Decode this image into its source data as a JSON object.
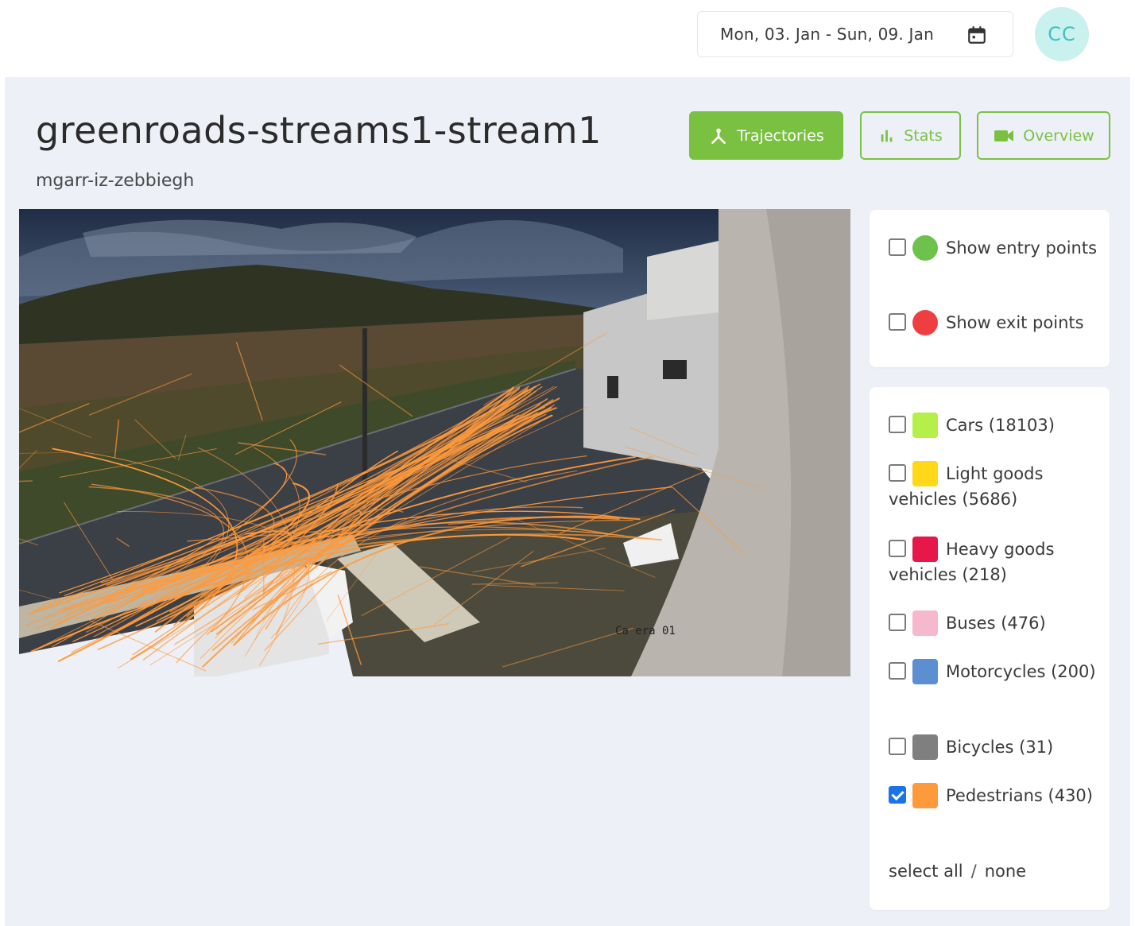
{
  "header": {
    "date_range": "Mon, 03. Jan - Sun, 09. Jan",
    "calendar_icon": "calendar-icon",
    "avatar_initials": "CC"
  },
  "page": {
    "title": "greenroads-streams1-stream1",
    "subtitle": "mgarr-iz-zebbiegh"
  },
  "views": {
    "trajectories": "Trajectories",
    "stats": "Stats",
    "overview": "Overview"
  },
  "camera": {
    "overlay_text": "Ca era 01",
    "trajectory_color": "#ff9a3c"
  },
  "points": [
    {
      "label": "Show entry points",
      "color": "#6cc24a",
      "checked": false
    },
    {
      "label": "Show exit points",
      "color": "#ef3e42",
      "checked": false
    }
  ],
  "classes": [
    {
      "label": "Cars (18103)",
      "color": "#b5ef4a",
      "checked": false
    },
    {
      "label": "Light goods vehicles (5686)",
      "color": "#ffd81a",
      "checked": false
    },
    {
      "label": "Heavy goods vehicles (218)",
      "color": "#e8174a",
      "checked": false
    },
    {
      "label": "Buses (476)",
      "color": "#f6b8cc",
      "checked": false
    },
    {
      "label": "Motorcycles (200)",
      "color": "#5b8fd1",
      "checked": false
    },
    {
      "label": "Bicycles (31)",
      "color": "#7f7f7f",
      "checked": false
    },
    {
      "label": "Pedestrians (430)",
      "color": "#ff9a3c",
      "checked": true
    }
  ],
  "selection": {
    "all": "select all",
    "separator": "/",
    "none": "none"
  },
  "colors": {
    "accent": "#7ac142",
    "background": "#eef0f8",
    "avatar_bg": "#c9f1ee",
    "avatar_text": "#3cc1c6"
  }
}
